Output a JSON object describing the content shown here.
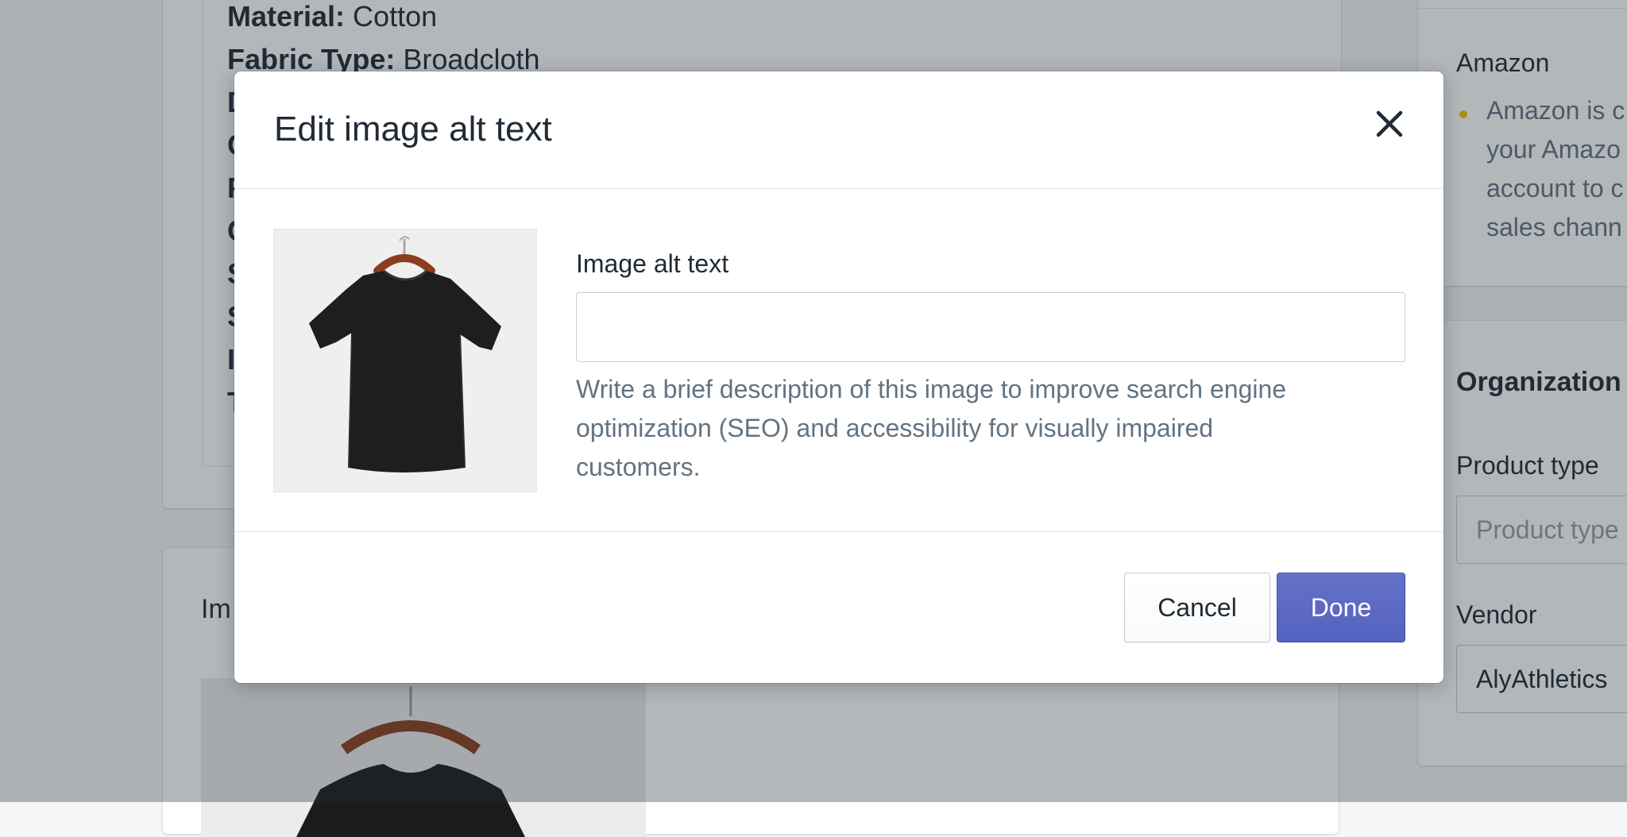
{
  "background": {
    "description_lines": [
      {
        "label": "Material:",
        "value": " Cotton"
      },
      {
        "label": "Fabric Type:",
        "value": " Broadcloth"
      },
      {
        "label": "D",
        "value": ""
      },
      {
        "label": "C",
        "value": ""
      },
      {
        "label": "F",
        "value": ""
      },
      {
        "label": "C",
        "value": ""
      },
      {
        "label": "S",
        "value": ""
      },
      {
        "label": "S",
        "value": ""
      },
      {
        "label": "I",
        "value": ""
      },
      {
        "label": "T",
        "value": ""
      }
    ],
    "media_title": "Im",
    "sales_channel": {
      "name": "Amazon",
      "lines": [
        "Amazon is c",
        "your Amazo",
        "account to c",
        "sales chann"
      ]
    },
    "organization": {
      "title": "Organization",
      "product_type_label": "Product type",
      "product_type_placeholder": "Product type",
      "vendor_label": "Vendor",
      "vendor_value": "AlyAthletics"
    }
  },
  "modal": {
    "title": "Edit image alt text",
    "close_icon": "close-icon",
    "field_label": "Image alt text",
    "field_value": "",
    "help_text": "Write a brief description of this image to improve search engine optimization (SEO) and accessibility for visually impaired customers.",
    "cancel_label": "Cancel",
    "done_label": "Done",
    "product_image": "black-tshirt-on-hanger"
  },
  "colors": {
    "primary": "#5c6ac4",
    "text": "#212b36",
    "subdued": "#637381",
    "warning_dot": "#eec200"
  }
}
